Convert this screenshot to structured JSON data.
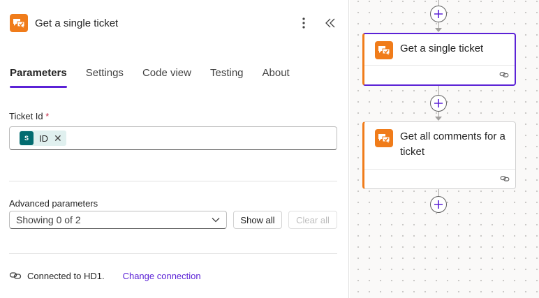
{
  "panel": {
    "title": "Get a single ticket",
    "tabs": [
      {
        "label": "Parameters"
      },
      {
        "label": "Settings"
      },
      {
        "label": "Code view"
      },
      {
        "label": "Testing"
      },
      {
        "label": "About"
      }
    ],
    "ticket_field": {
      "label": "Ticket Id",
      "required_mark": "*",
      "token_text": "ID",
      "token_icon_letter": "S"
    },
    "advanced": {
      "label": "Advanced parameters",
      "select_value": "Showing 0 of 2",
      "show_all_label": "Show all",
      "clear_all_label": "Clear all"
    },
    "connection": {
      "text": "Connected to HD1.",
      "link_label": "Change connection"
    }
  },
  "canvas": {
    "cards": [
      {
        "title": "Get a single ticket",
        "selected": true
      },
      {
        "title": "Get all comments for a ticket",
        "selected": false
      }
    ]
  },
  "colors": {
    "accent": "#5b22d6",
    "app_orange": "#f07c1a",
    "sharepoint_teal": "#036c70"
  },
  "icons": [
    "app-icon",
    "more-icon",
    "collapse-icon",
    "sharepoint-icon",
    "close-icon",
    "chevron-down-icon",
    "link-icon",
    "plus-icon"
  ]
}
